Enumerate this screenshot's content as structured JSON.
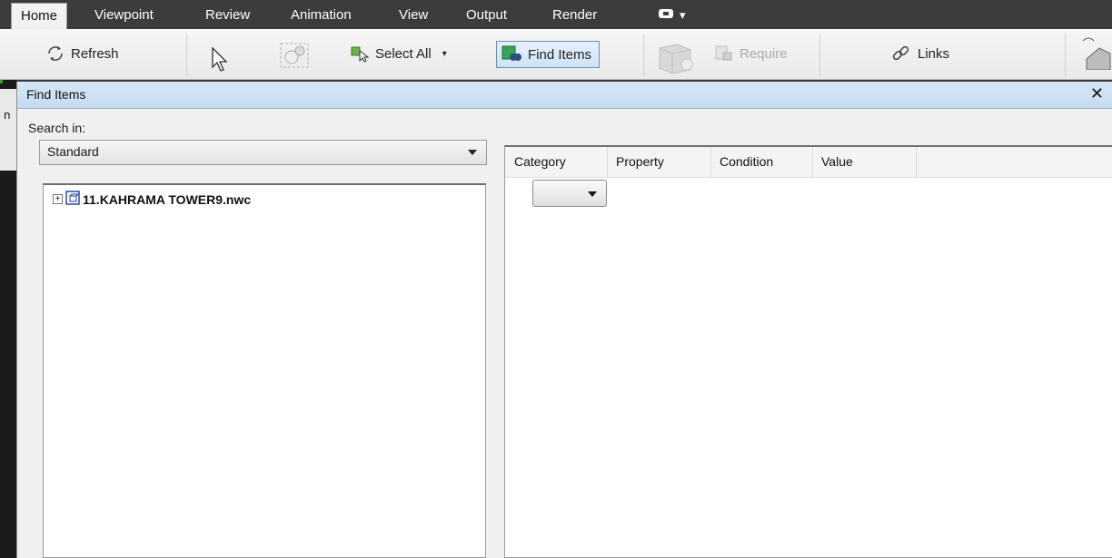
{
  "ribbon": {
    "tabs": [
      {
        "label": "Home",
        "active": true
      },
      {
        "label": "Viewpoint"
      },
      {
        "label": "Review"
      },
      {
        "label": "Animation"
      },
      {
        "label": "View"
      },
      {
        "label": "Output"
      },
      {
        "label": "Render"
      }
    ],
    "cloud_menu": "▾",
    "buttons": {
      "refresh": "Refresh",
      "select_all": "Select All",
      "find_items": "Find Items",
      "require": "Require",
      "links": "Links"
    }
  },
  "left_strip_text": "n",
  "find_items": {
    "title": "Find Items",
    "close": "✕",
    "search_in_label": "Search in:",
    "search_in_value": "Standard",
    "tree": {
      "expander": "+",
      "file": "11.KAHRAMA TOWER9.nwc"
    },
    "grid_columns": [
      "Category",
      "Property",
      "Condition",
      "Value"
    ]
  },
  "colors": {
    "panel_header": "#c4dbf0",
    "ribbon_dark": "#3c3c3c",
    "selected_button": "#cfe2f5"
  }
}
